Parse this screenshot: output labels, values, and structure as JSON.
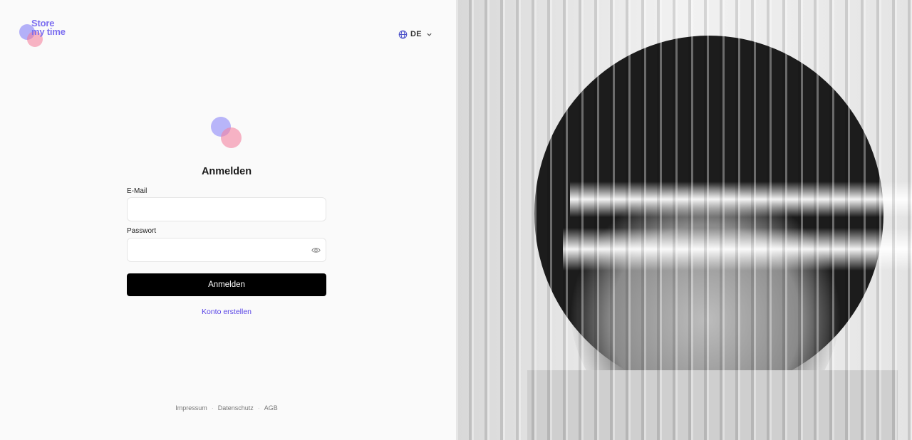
{
  "brand": {
    "word_line1": "Store",
    "word_line2": "my time",
    "accent_color": "#7c6ef0",
    "secondary_color": "#f47896"
  },
  "language": {
    "selected": "DE",
    "icon": "globe-icon",
    "chevron": "chevron-down-icon"
  },
  "form": {
    "title": "Anmelden",
    "email_label": "E-Mail",
    "email_value": "",
    "password_label": "Passwort",
    "password_value": "",
    "password_toggle_icon": "eye-icon",
    "submit_label": "Anmelden",
    "create_account_label": "Konto erstellen",
    "link_color": "#5a46e6",
    "button_color": "#000000"
  },
  "footer": {
    "links": [
      "Impressum",
      "Datenschutz",
      "AGB"
    ]
  }
}
